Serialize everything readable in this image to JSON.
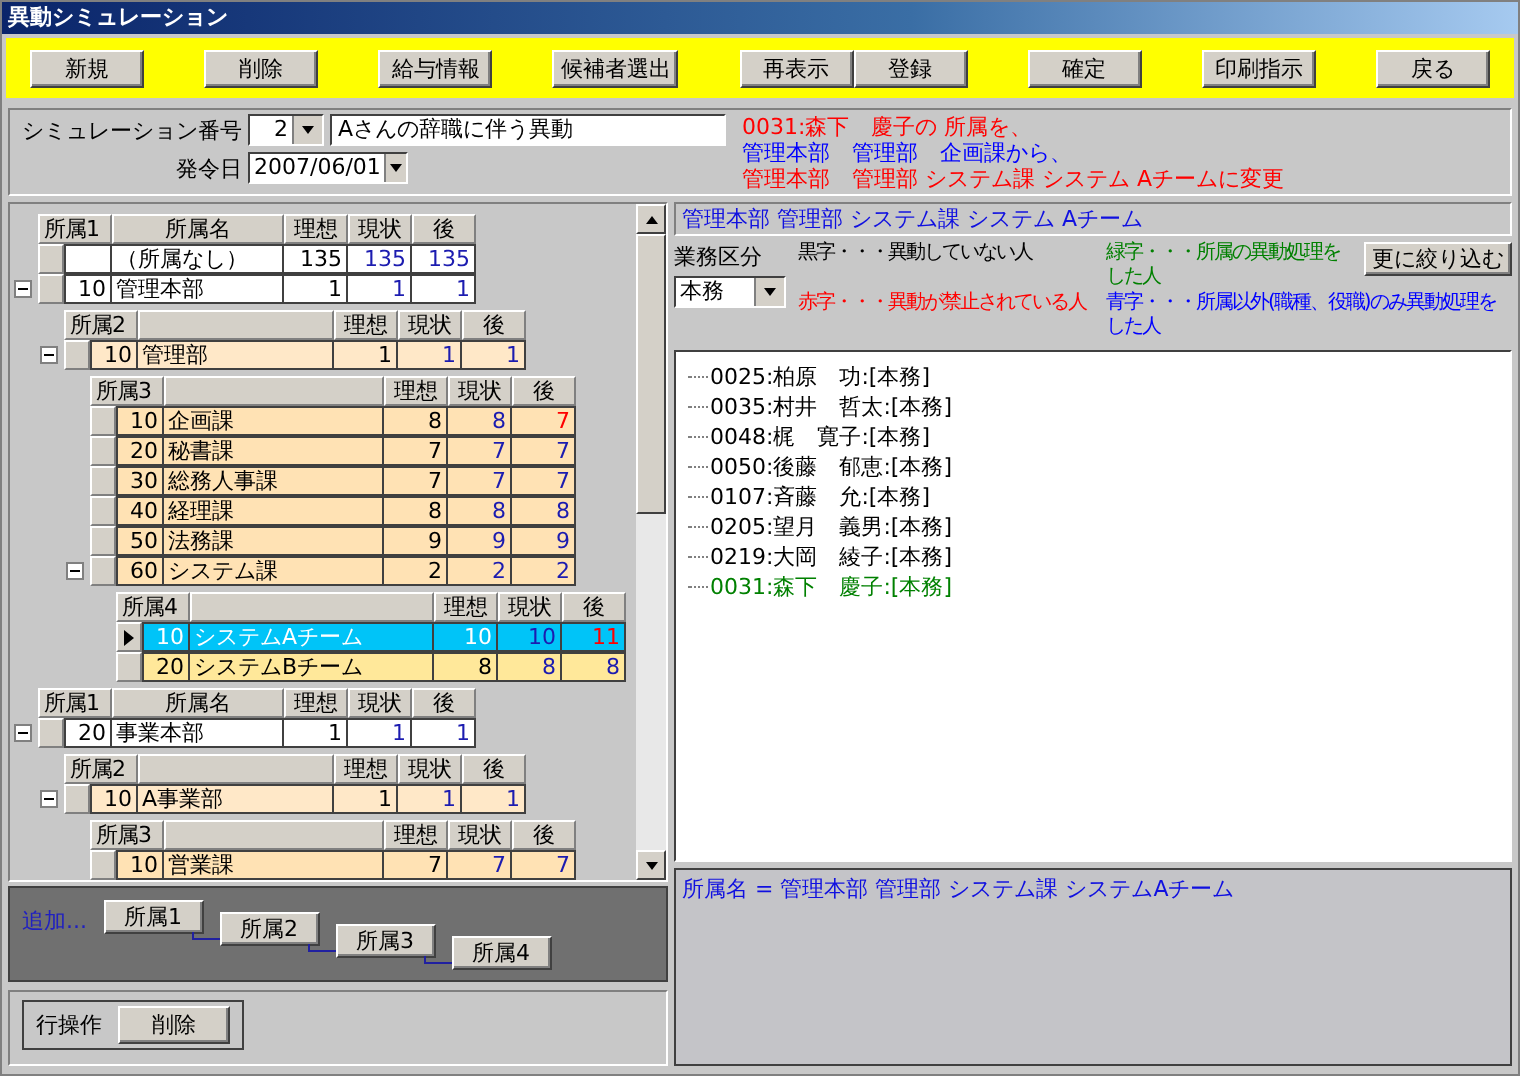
{
  "window": {
    "title": "異動シミュレーション"
  },
  "toolbar": [
    [
      "新規"
    ],
    [
      "削除"
    ],
    [
      "給与情報"
    ],
    [
      "候補者選出"
    ],
    [
      "再表示",
      "登録"
    ],
    [
      "確定"
    ],
    [
      "印刷指示"
    ],
    [
      "戻る"
    ]
  ],
  "simulation": {
    "number_label": "シミュレーション番号",
    "number": "2",
    "name": "Aさんの辞職に伴う異動",
    "date_label": "発令日",
    "date": "2007/06/01"
  },
  "message": [
    {
      "text": "0031:森下　慶子の 所属を、",
      "color": "#ff0000"
    },
    {
      "text": "管理本部　管理部　企画課から、",
      "color": "#0000ff"
    },
    {
      "text": "管理本部　管理部 システム課 システム Aチームに変更",
      "color": "#ff0000"
    }
  ],
  "org_tree": [
    {
      "level": "所属1",
      "name_header": "所属名",
      "columns": [
        "理想",
        "現状",
        "後"
      ],
      "rows": [
        {
          "code": "",
          "name": "（所属なし）",
          "ideal": "135",
          "current": "135",
          "after": "135",
          "after_changed": false,
          "selected": false
        },
        {
          "code": "10",
          "name": "管理本部",
          "ideal": "1",
          "current": "1",
          "after": "1",
          "after_changed": false,
          "selected": false,
          "expanded": true,
          "children": [
            {
              "level": "所属2",
              "columns": [
                "理想",
                "現状",
                "後"
              ],
              "rows": [
                {
                  "code": "10",
                  "name": "管理部",
                  "ideal": "1",
                  "current": "1",
                  "after": "1",
                  "after_changed": false,
                  "selected": false,
                  "expanded": true,
                  "children": [
                    {
                      "level": "所属3",
                      "columns": [
                        "理想",
                        "現状",
                        "後"
                      ],
                      "rows": [
                        {
                          "code": "10",
                          "name": "企画課",
                          "ideal": "8",
                          "current": "8",
                          "after": "7",
                          "after_changed": true,
                          "selected": false
                        },
                        {
                          "code": "20",
                          "name": "秘書課",
                          "ideal": "7",
                          "current": "7",
                          "after": "7",
                          "after_changed": false,
                          "selected": false
                        },
                        {
                          "code": "30",
                          "name": "総務人事課",
                          "ideal": "7",
                          "current": "7",
                          "after": "7",
                          "after_changed": false,
                          "selected": false
                        },
                        {
                          "code": "40",
                          "name": "経理課",
                          "ideal": "8",
                          "current": "8",
                          "after": "8",
                          "after_changed": false,
                          "selected": false
                        },
                        {
                          "code": "50",
                          "name": "法務課",
                          "ideal": "9",
                          "current": "9",
                          "after": "9",
                          "after_changed": false,
                          "selected": false
                        },
                        {
                          "code": "60",
                          "name": "システム課",
                          "ideal": "2",
                          "current": "2",
                          "after": "2",
                          "after_changed": false,
                          "selected": false,
                          "expanded": true,
                          "children": [
                            {
                              "level": "所属4",
                              "columns": [
                                "理想",
                                "現状",
                                "後"
                              ],
                              "rows": [
                                {
                                  "code": "10",
                                  "name": "システムAチーム",
                                  "ideal": "10",
                                  "current": "10",
                                  "after": "11",
                                  "after_changed": true,
                                  "selected": true
                                },
                                {
                                  "code": "20",
                                  "name": "システムBチーム",
                                  "ideal": "8",
                                  "current": "8",
                                  "after": "8",
                                  "after_changed": false,
                                  "selected": false
                                }
                              ]
                            }
                          ]
                        }
                      ]
                    }
                  ]
                }
              ]
            }
          ]
        }
      ]
    },
    {
      "level": "所属1",
      "name_header": "所属名",
      "columns": [
        "理想",
        "現状",
        "後"
      ],
      "rows": [
        {
          "code": "20",
          "name": "事業本部",
          "ideal": "1",
          "current": "1",
          "after": "1",
          "after_changed": false,
          "selected": false,
          "expanded": true,
          "children": [
            {
              "level": "所属2",
              "columns": [
                "理想",
                "現状",
                "後"
              ],
              "rows": [
                {
                  "code": "10",
                  "name": "A事業部",
                  "ideal": "1",
                  "current": "1",
                  "after": "1",
                  "after_changed": false,
                  "selected": false,
                  "expanded": true,
                  "children": [
                    {
                      "level": "所属3",
                      "columns": [
                        "理想",
                        "現状",
                        "後"
                      ],
                      "rows": [
                        {
                          "code": "10",
                          "name": "営業課",
                          "ideal": "7",
                          "current": "7",
                          "after": "7",
                          "after_changed": false,
                          "selected": false
                        }
                      ]
                    }
                  ]
                }
              ]
            }
          ]
        }
      ]
    }
  ],
  "tree_add": {
    "label": "追加...",
    "buttons": [
      "所属1",
      "所属2",
      "所属3",
      "所属4"
    ]
  },
  "row_ops": {
    "label": "行操作",
    "button": "削除"
  },
  "path": "管理本部 管理部 システム課 システム Aチーム",
  "duty": {
    "label": "業務区分",
    "value": "本務"
  },
  "legend": [
    {
      "text": "黒字・・・異動していない人",
      "color": "#000000"
    },
    {
      "text": "緑字・・・所属の異動処理をした人",
      "color": "#008000"
    },
    {
      "text": "赤字・・・異動が禁止されている人",
      "color": "#ff0000"
    },
    {
      "text": "青字・・・所属以外(職種、役職)のみ異動処理をした人",
      "color": "#0000ff"
    }
  ],
  "filter_button": "更に絞り込む",
  "employees": [
    {
      "text": "0025:柏原　功:[本務]",
      "color": "#000000"
    },
    {
      "text": "0035:村井　哲太:[本務]",
      "color": "#000000"
    },
    {
      "text": "0048:梶　寛子:[本務]",
      "color": "#000000"
    },
    {
      "text": "0050:後藤　郁恵:[本務]",
      "color": "#000000"
    },
    {
      "text": "0107:斉藤　允:[本務]",
      "color": "#000000"
    },
    {
      "text": "0205:望月　義男:[本務]",
      "color": "#000000"
    },
    {
      "text": "0219:大岡　綾子:[本務]",
      "color": "#000000"
    },
    {
      "text": "0031:森下　慶子:[本務]",
      "color": "#008000"
    }
  ],
  "info": "所属名 = 管理本部 管理部 システム課 システムAチーム"
}
